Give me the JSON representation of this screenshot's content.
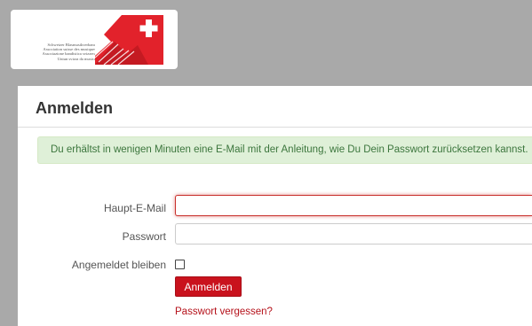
{
  "logo": {
    "lines": [
      "Schweizer Blasmusikverband",
      "Association suisse des musiques",
      "Associazione bandistica svizzera",
      "Uniun svizra da musica"
    ]
  },
  "login": {
    "title": "Anmelden",
    "alert": "Du erhältst in wenigen Minuten eine E-Mail mit der Anleitung, wie Du Dein Passwort zurücksetzen kannst.",
    "email_label": "Haupt-E-Mail",
    "email_value": "",
    "password_label": "Passwort",
    "password_value": "",
    "remember_label": "Angemeldet bleiben",
    "remember_checked": false,
    "submit_label": "Anmelden",
    "forgot_link": "Passwort vergessen?"
  },
  "colors": {
    "brand_red": "#c9121d",
    "alert_bg": "#dff0d8",
    "alert_text": "#3c763d",
    "link": "#b5121b"
  }
}
